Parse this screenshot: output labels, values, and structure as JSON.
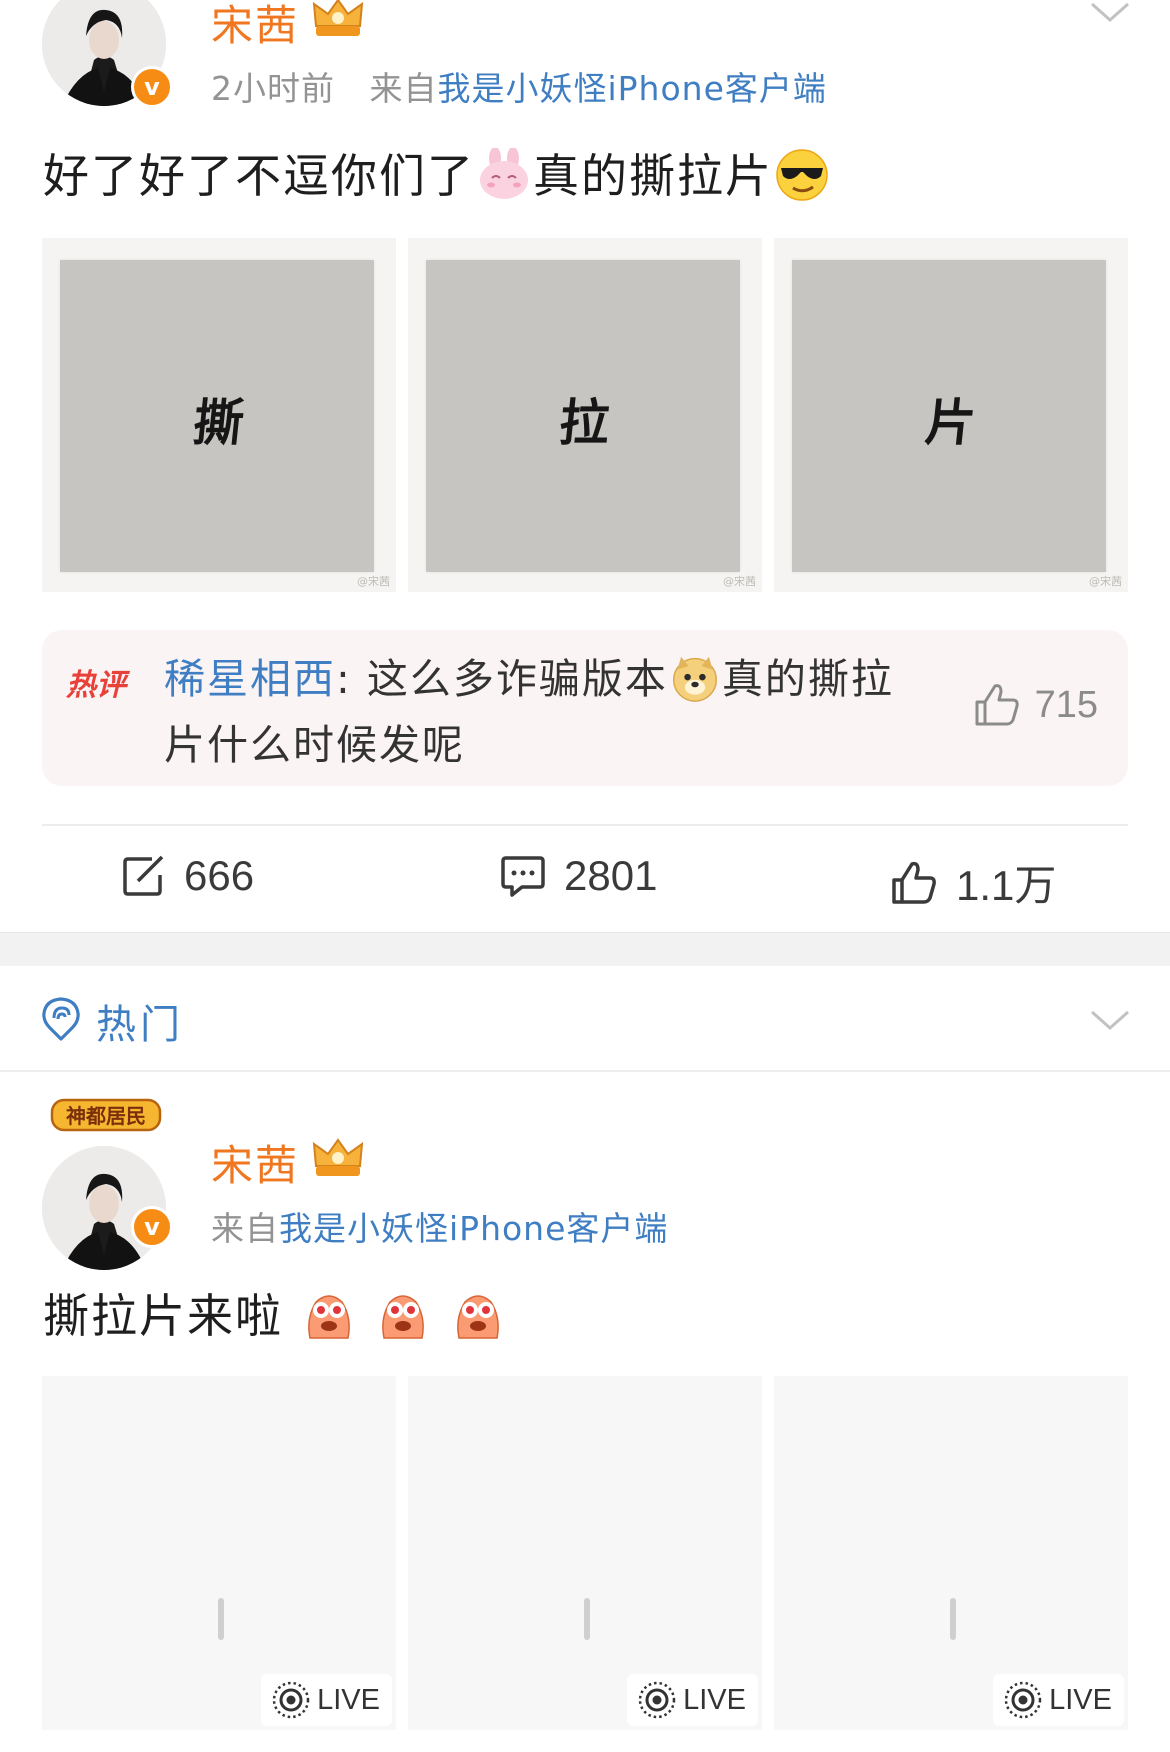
{
  "colors": {
    "username": "#f0761f",
    "link": "#3f7ec2",
    "meta": "#939393",
    "hot_tag": "#e8413a",
    "verified_badge": "#f78c15",
    "hot_comment_bg": "#fbf4f4"
  },
  "post1": {
    "username": "宋茜",
    "time": "2小时前",
    "source_prefix": "来自",
    "source": "我是小妖怪iPhone客户端",
    "text_part1": "好了好了不逗你们了",
    "emoji1": "pink-bunny-emoji",
    "text_part2": "真的撕拉片",
    "emoji2": "cool-sunglasses-emoji",
    "images": [
      {
        "glyph": "撕",
        "watermark": "@宋茜"
      },
      {
        "glyph": "拉",
        "watermark": "@宋茜"
      },
      {
        "glyph": "片",
        "watermark": "@宋茜"
      }
    ],
    "hot_comment": {
      "tag": "热评",
      "user": "稀星相西",
      "colon": ": ",
      "text_a": "这么多诈骗版本",
      "emoji": "doge-emoji",
      "text_b": "真的撕拉片什么时候发呢",
      "likes": "715"
    },
    "actions": {
      "reposts": "666",
      "comments": "2801",
      "likes_num": "1.1",
      "likes_unit": "万"
    }
  },
  "section": {
    "title": "热门"
  },
  "post2": {
    "medal": "神都居民",
    "username": "宋茜",
    "source_prefix": "来自",
    "source": "我是小妖怪iPhone客户端",
    "text": "撕拉片来啦",
    "emoji": "excited-monster-emoji",
    "images": [
      {
        "live_label": "LIVE"
      },
      {
        "live_label": "LIVE"
      },
      {
        "live_label": "LIVE"
      }
    ]
  }
}
